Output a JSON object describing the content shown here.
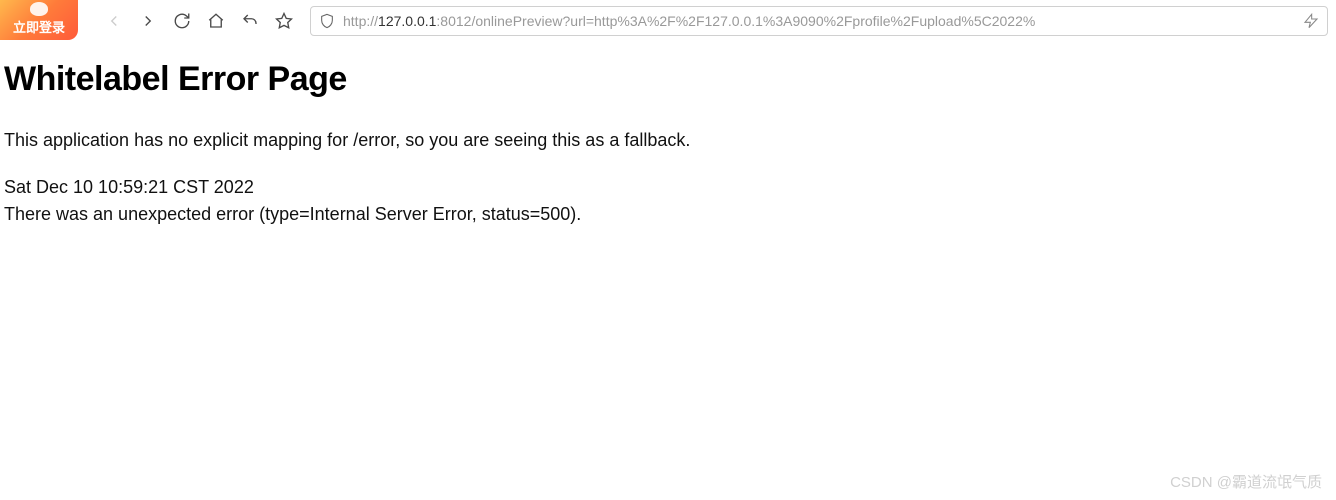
{
  "toolbar": {
    "login_badge": "立即登录",
    "url_protocol": "http://",
    "url_host": "127.0.0.1",
    "url_rest": ":8012/onlinePreview?url=http%3A%2F%2F127.0.0.1%3A9090%2Fprofile%2Fupload%5C2022%"
  },
  "page": {
    "title": "Whitelabel Error Page",
    "intro": "This application has no explicit mapping for /error, so you are seeing this as a fallback.",
    "timestamp": "Sat Dec 10 10:59:21 CST 2022",
    "error_detail": "There was an unexpected error (type=Internal Server Error, status=500)."
  },
  "watermark": "CSDN @霸道流氓气质"
}
